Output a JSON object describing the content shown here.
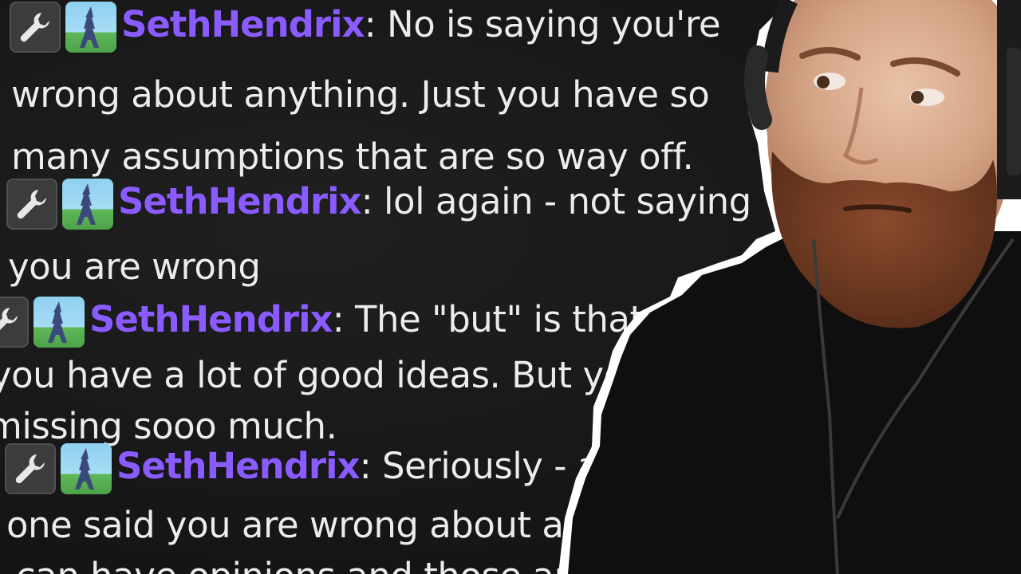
{
  "chat": {
    "messages": [
      {
        "username": "SethHendrix",
        "lines": [
          "No is saying you're",
          "wrong about anything. Just you have so",
          "many assumptions that are so way off."
        ]
      },
      {
        "username": "SethHendrix",
        "lines": [
          "lol again - not saying",
          "you are wrong"
        ]
      },
      {
        "username": "SethHendrix",
        "lines": [
          "The \"but\" is that I think",
          "you have a lot of good ideas. But you're",
          "missing sooo much."
        ]
      },
      {
        "username": "SethHendrix",
        "lines": [
          "Seriously - again",
          "one said you are wrong about anything",
          "can have opinions and those are fine"
        ]
      }
    ],
    "colon": ":"
  },
  "badges": {
    "moderator_icon": "wrench-icon",
    "subscriber_icon": "eiffel-tower-icon"
  },
  "colors": {
    "username": "#8a5cff",
    "message_text": "#ececec",
    "chat_background": "#161616",
    "streamer_outline": "#ffffff"
  }
}
